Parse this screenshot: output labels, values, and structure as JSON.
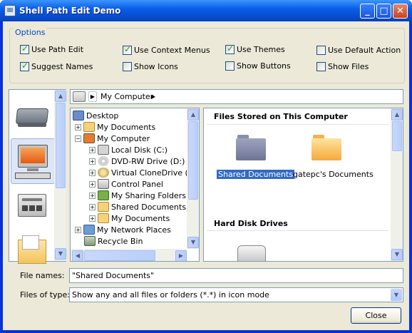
{
  "window": {
    "title": "Shell Path Edit Demo",
    "min": "_",
    "max": "□",
    "close": "✕"
  },
  "options": {
    "legend": "Options",
    "items": [
      {
        "label": "Use Path Edit",
        "checked": true
      },
      {
        "label": "Use Context Menus",
        "checked": true
      },
      {
        "label": "Use Themes",
        "checked": true
      },
      {
        "label": "Use Default Action",
        "checked": false
      },
      {
        "label": "Suggest Names",
        "checked": true
      },
      {
        "label": "Show Icons",
        "checked": false
      },
      {
        "label": "Show Buttons",
        "checked": false
      },
      {
        "label": "Show Files",
        "checked": false
      }
    ]
  },
  "address": {
    "location": "My Computer",
    "arrow": "▶"
  },
  "tree": {
    "items": [
      {
        "label": "Desktop",
        "expander": ""
      },
      {
        "label": "My Documents",
        "expander": "+"
      },
      {
        "label": "My Computer",
        "expander": "−"
      },
      {
        "label": "Local Disk (C:)",
        "expander": "+"
      },
      {
        "label": "DVD-RW Drive (D:)",
        "expander": "+"
      },
      {
        "label": "Virtual CloneDrive (E",
        "expander": "+"
      },
      {
        "label": "Control Panel",
        "expander": "+"
      },
      {
        "label": "My Sharing Folders",
        "expander": "+"
      },
      {
        "label": "Shared Documents",
        "expander": "+"
      },
      {
        "label": "My Documents",
        "expander": "+"
      },
      {
        "label": "My Network Places",
        "expander": "+"
      },
      {
        "label": "Recycle Bin",
        "expander": ""
      }
    ]
  },
  "content": {
    "group1": "Files Stored on This Computer",
    "folders": [
      {
        "label": "Shared Documents",
        "selected": true
      },
      {
        "label": "gatepc's Documents",
        "selected": false
      }
    ],
    "group2": "Hard Disk Drives"
  },
  "file_names": {
    "label": "File names:",
    "value": "\"Shared Documents\""
  },
  "file_type": {
    "label": "Files of type:",
    "value": "Show any and all files or folders (*.*) in icon mode"
  },
  "close_button": "Close",
  "colors": {
    "title_bar": "#0a5fe8",
    "dialog_bg": "#ece9d8",
    "selection": "#316ac5",
    "group_header_accent": "#0046d5"
  }
}
